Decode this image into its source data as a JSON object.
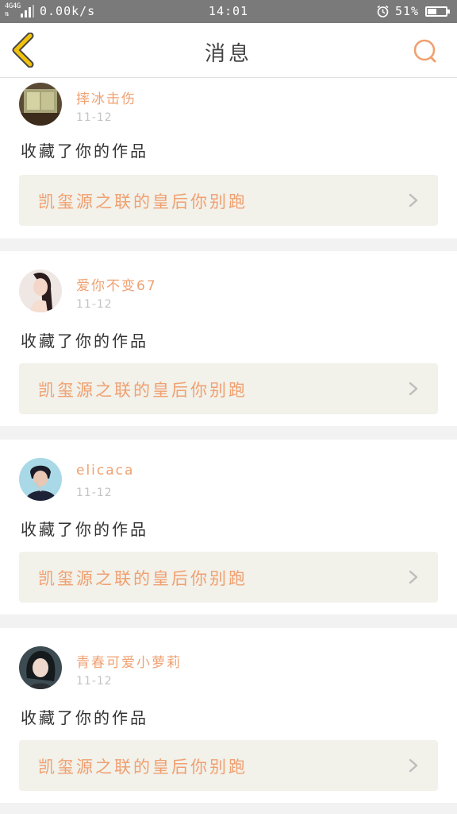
{
  "status_bar": {
    "network_top": "4G4G",
    "network_bottom": "⇅",
    "speed": "0.00k/s",
    "time": "14:01",
    "battery_percent": "51%",
    "battery_level": 0.51
  },
  "header": {
    "title": "消息",
    "back_icon": "chevron-left-icon",
    "search_icon": "search-icon"
  },
  "colors": {
    "accent": "#f0a070",
    "back_icon": "#e6c200",
    "link_background": "#f2f1ea"
  },
  "messages": [
    {
      "username": "摔冰击伤",
      "date": "11-12",
      "action": "收藏了你的作品",
      "work_title": "凯玺源之联的皇后你别跑"
    },
    {
      "username": "爱你不变67",
      "date": "11-12",
      "action": "收藏了你的作品",
      "work_title": "凯玺源之联的皇后你别跑"
    },
    {
      "username": "elicaca",
      "date": "11-12",
      "action": "收藏了你的作品",
      "work_title": "凯玺源之联的皇后你别跑"
    },
    {
      "username": "青春可爱小萝莉",
      "date": "11-12",
      "action": "收藏了你的作品",
      "work_title": "凯玺源之联的皇后你别跑"
    }
  ]
}
